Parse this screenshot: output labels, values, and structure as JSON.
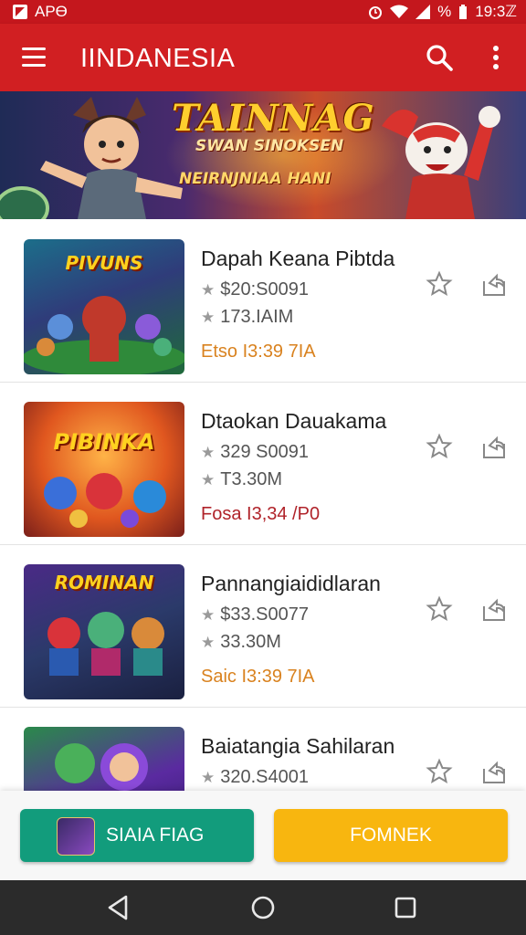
{
  "status_bar": {
    "carrier": "APϴ",
    "battery": "%",
    "time": "19:3ℤ"
  },
  "app_bar": {
    "title": "IINDANESIA",
    "icons": [
      "menu-icon",
      "search-icon",
      "more-vert-icon"
    ]
  },
  "banner": {
    "title": "TAINNAG",
    "subtitle": "SWAN SINOKSEN",
    "tagline": "NEIRNJNIAA HANI"
  },
  "list": {
    "items": [
      {
        "name": "Dapah Keana Pibtda",
        "price": "$20:S0091",
        "size": "173.IAIM",
        "date": "Etso I3:39 7IA",
        "thumb_title": "PIVUNS",
        "date_color": "#d9821f"
      },
      {
        "name": "Dtaokan Dauakama",
        "price": "329 S0091",
        "size": "T3.30M",
        "date": "Fosa I3,34 /P0",
        "thumb_title": "PIBINKA",
        "date_color": "#b0232a"
      },
      {
        "name": "Pannangiaididlaran",
        "price": "$33.S0077",
        "size": "33.30M",
        "date": "Saic I3:39 7IA",
        "thumb_title": "ROMINAN",
        "date_color": "#d9821f"
      },
      {
        "name": "Baiatangia Sahilaran",
        "price": "320.S4001",
        "size": "",
        "date": "",
        "thumb_title": "",
        "date_color": "#d9821f"
      }
    ]
  },
  "actions": {
    "primary": "SIAIA FIAG",
    "secondary": "FOMNEK"
  },
  "colors": {
    "app_bar": "#d11f22",
    "green_button": "#129c7c",
    "yellow_button": "#f8b60f"
  }
}
